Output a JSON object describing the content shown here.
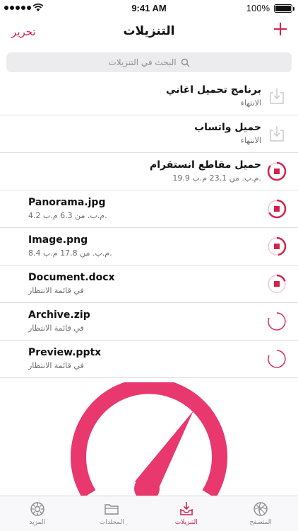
{
  "status": {
    "time": "9:41 AM",
    "battery": "100%"
  },
  "nav": {
    "title": "التنزيلات",
    "edit_label": "تحرير"
  },
  "search": {
    "placeholder": "البحث في التنزيلات"
  },
  "downloads": [
    {
      "title": "برنامج تحميل اغاني",
      "subtitle": "الانتهاء",
      "state": "done-icon"
    },
    {
      "title": "حميل واتساب",
      "subtitle": "الانتهاء",
      "state": "done-icon"
    },
    {
      "title": "حميل مقاطع انستقرام",
      "subtitle": "19.9 م.ب. من 23.1 م.ب.",
      "state": "stop-icon",
      "progress": 0.86
    },
    {
      "title": "Panorama.jpg",
      "subtitle": "4.2 م.ب. من 6.3 م.ب.",
      "state": "stop-icon",
      "progress": 0.67
    },
    {
      "title": "Image.png",
      "subtitle": "8.4 م.ب. من 17.8 م.ب.",
      "state": "stop-icon",
      "progress": 0.47
    },
    {
      "title": "Document.docx",
      "subtitle": "في قائمة الانتظار",
      "state": "stop-icon",
      "progress": 0.2
    },
    {
      "title": "Archive.zip",
      "subtitle": "في قائمة الانتظار",
      "state": "queued-icon"
    },
    {
      "title": "Preview.pptx",
      "subtitle": "في قائمة الانتظار",
      "state": "queued-icon"
    }
  ],
  "tabs": [
    {
      "label": "المزيد",
      "icon": "gear-icon"
    },
    {
      "label": "المجلدات",
      "icon": "folder-icon"
    },
    {
      "label": "التنزيلات",
      "icon": "download-tray-icon",
      "active": true
    },
    {
      "label": "المتصفح",
      "icon": "globe-icon"
    }
  ],
  "colors": {
    "accent": "#d3234c",
    "gauge": "#e8386e"
  }
}
